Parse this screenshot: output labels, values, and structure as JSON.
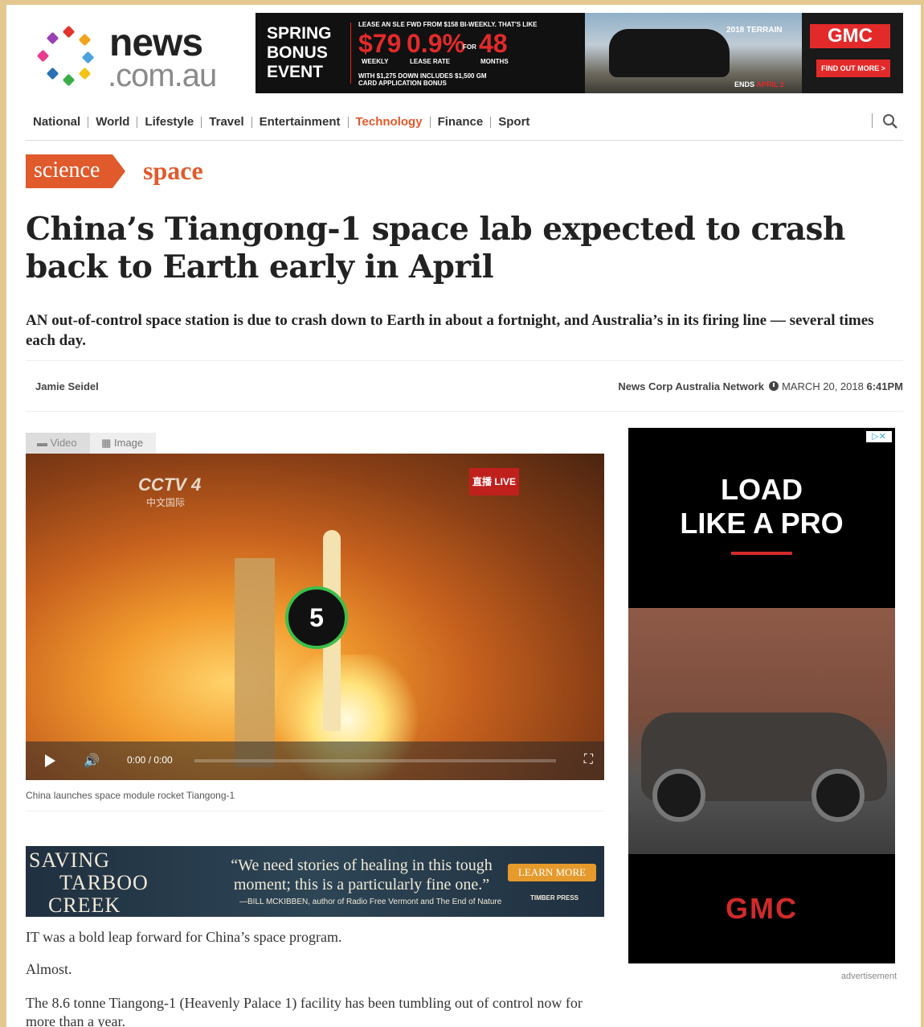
{
  "header": {
    "logo_top": "news",
    "logo_bottom": ".com.au",
    "ad": {
      "spring": "SPRING",
      "bonus": "BONUS",
      "event": "EVENT",
      "lease_line": "LEASE AN SLE FWD FROM $158 BI-WEEKLY. THAT'S LIKE",
      "weekly_value": "$79",
      "weekly_label": "WEEKLY",
      "rate_value": "0.9%",
      "rate_label": "LEASE RATE",
      "for_label": "FOR",
      "months_value": "48",
      "months_label": "MONTHS",
      "fine_print": "WITH $1,275 DOWN INCLUDES $1,500 GM CARD APPLICATION BONUS",
      "terrain": "2018 TERRAIN",
      "ends": "ENDS",
      "ends_date": "APRIL 2",
      "brand": "GMC",
      "cta": "FIND OUT MORE >"
    }
  },
  "nav": {
    "items": [
      "National",
      "World",
      "Lifestyle",
      "Travel",
      "Entertainment",
      "Technology",
      "Finance",
      "Sport"
    ],
    "active": "Technology"
  },
  "section": {
    "label": "science",
    "sub": "space"
  },
  "article": {
    "headline": "China’s Tiangong-1 space lab expected to crash back to Earth early in April",
    "standfirst": "AN out-of-control space station is due to crash down to Earth in about a fortnight, and Australia’s in its firing line — several times each day.",
    "author": "Jamie Seidel",
    "network": "News Corp Australia Network",
    "date": "MARCH 20, 2018",
    "time": "6:41PM",
    "paragraphs": [
      "IT was a bold leap forward for China’s space program.",
      "Almost.",
      "The 8.6 tonne Tiangong-1 (Heavenly Palace 1) facility has been tumbling out of control now for more than a year."
    ]
  },
  "media": {
    "tabs": [
      "Video",
      "Image"
    ],
    "active_tab": "Video",
    "channel": "CCTV 4",
    "channel_sub": "中文国际",
    "live": "直播 LIVE",
    "countdown": "5",
    "time_current": "0:00",
    "time_total": "0:00",
    "caption": "China launches space module rocket Tiangong-1"
  },
  "book_ad": {
    "title_line1": "SAVING",
    "title_line2": "TARBOO",
    "title_line3": "CREEK",
    "quote": "“We need stories of healing in this tough moment; this is a particularly fine one.”",
    "attribution": "—BILL MCKIBBEN, author of Radio Free Vermont and The End of Nature",
    "cta": "LEARN MORE",
    "publisher": "TIMBER PRESS"
  },
  "side_ad": {
    "headline_1": "LOAD",
    "headline_2": "LIKE A PRO",
    "brand": "GMC",
    "label": "advertisement"
  },
  "colors": {
    "accent": "#e05a2b",
    "gmc_red": "#d12a2a",
    "live_red": "#c0201c",
    "countdown_ring": "#3cbf4a"
  }
}
